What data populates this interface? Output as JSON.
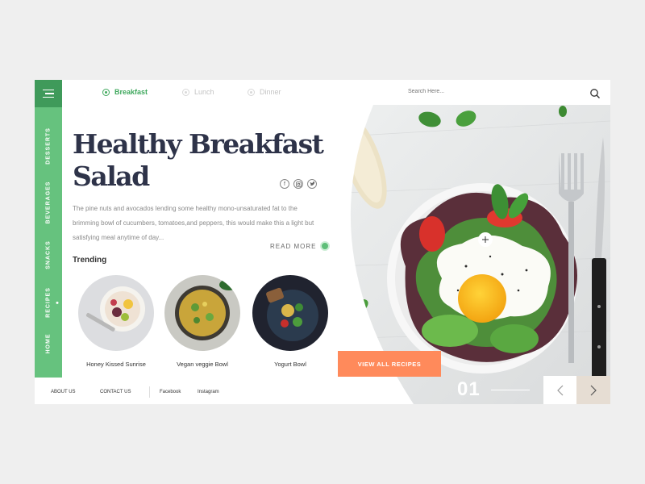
{
  "nav": {
    "tabs": [
      {
        "label": "Breakfast",
        "active": true
      },
      {
        "label": "Lunch",
        "active": false
      },
      {
        "label": "Dinner",
        "active": false
      }
    ]
  },
  "sidebar": {
    "items": [
      {
        "label": "DESSERTS",
        "active": false
      },
      {
        "label": "BEVERAGES",
        "active": false
      },
      {
        "label": "SNACKS",
        "active": false
      },
      {
        "label": "RECIPES",
        "active": true
      },
      {
        "label": "HOME",
        "active": false
      }
    ]
  },
  "search": {
    "placeholder": "Search Here..."
  },
  "hero": {
    "title_line1": "Healthy Breakfast",
    "title_line2": "Salad",
    "description": "The pine nuts and avocados lending some healthy mono-unsaturated fat to the brimming bowl of cucumbers, tomatoes,and peppers, this would make this a light but satisfying meal anytime of day...",
    "read_more": "READ MORE",
    "social": [
      "facebook-icon",
      "instagram-icon",
      "twitter-icon"
    ]
  },
  "trending": {
    "heading": "Trending",
    "items": [
      {
        "name": "Honey Kissed Sunrise"
      },
      {
        "name": "Vegan veggie Bowl"
      },
      {
        "name": "Yogurt Bowl"
      }
    ]
  },
  "cta": {
    "view_all": "VIEW ALL RECIPES"
  },
  "slider": {
    "counter": "01"
  },
  "footer": {
    "links": [
      "ABOUT US",
      "CONTACT US",
      "Facebook",
      "Instagram"
    ]
  },
  "colors": {
    "sidebar": "#66c27e",
    "menu": "#3f9a5a",
    "accent": "#3fa85d",
    "cta": "#ff8a5b",
    "title": "#2e3349"
  }
}
